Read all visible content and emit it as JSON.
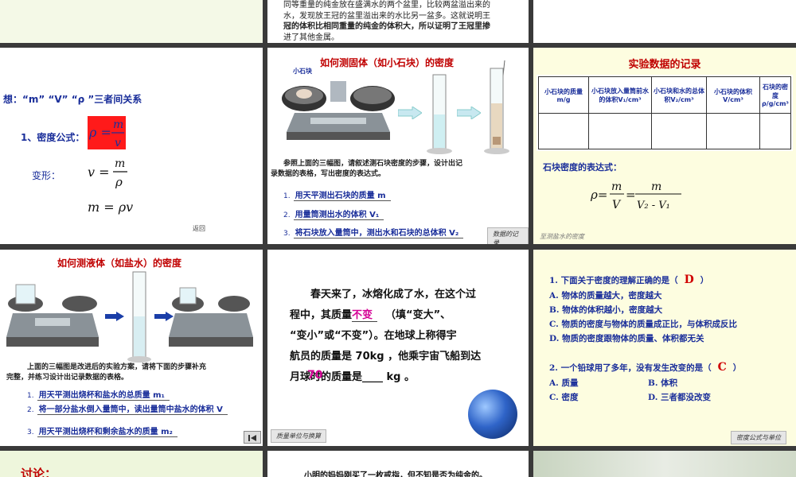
{
  "s1": {
    "text_lines": [
      "同等重量的纯金放在盛满水的两个盆里，比较两盆溢出来的",
      "水，发现放王冠的盆里溢出来的水比另一盆多。这就说明王",
      "冠的体积比相同重量的纯金的体积大，所以证明了王冠里掺",
      "进了其他金属。"
    ]
  },
  "s2": {
    "heading": "想：“m” “V” “ρ ”三者间关系",
    "formula_label": "1、密度公式：",
    "transform_label": "变形：",
    "back": "返回"
  },
  "s3": {
    "title": "如何测固体（如小石块）的密度",
    "stone_label": "小石块",
    "intro": [
      "参照上面的三幅图，请叙述测石块密度的步骤，设计出记",
      "录数据的表格，写出密度的表达式。"
    ],
    "steps": [
      {
        "num": "1.",
        "text": "用天平测出石块的质量 m"
      },
      {
        "num": "2.",
        "text": "用量筒测出水的体积 V₁"
      },
      {
        "num": "3.",
        "text": "将石块放入量筒中，测出水和石块的总体积 V₂"
      }
    ],
    "nav": "数据的记录"
  },
  "s4": {
    "title": "实验数据的记录",
    "headers": [
      "小石块的质量m/g",
      "小石块放入量筒前水的体积V₁/cm³",
      "小石块和水的总体积V₂/cm³",
      "小石块的体积V/cm³",
      "石块的密度ρ/g/cm³"
    ],
    "expr_label": "石块密度的表达式：",
    "nav": "至测盐水的密度"
  },
  "s5": {
    "title": "如何测液体（如盐水）的密度",
    "intro": [
      "上面的三幅图是改进后的实验方案，请将下面的步骤补充",
      "完整，并练习设计出记录数据的表格。"
    ],
    "steps": [
      {
        "num": "1.",
        "text": "用天平测出烧杯和盐水的总质量 m₁"
      },
      {
        "num": "2.",
        "text": "将一部分盐水倒入量筒中，读出量筒中盐水的体积 V"
      },
      {
        "num": "3.",
        "text": "用天平测出烧杯和剩余盐水的质量 m₂"
      }
    ]
  },
  "s6": {
    "lines": [
      "春天来了，冰熔化成了水，在这个过",
      "程中，其质量",
      "（填“变大”、",
      "“变小”或“不变”）。在地球上称得宇",
      "航员的质量是 70kg ，他乘宇宙飞船到达",
      "月球时的质量是____ kg 。"
    ],
    "answer1": "不变",
    "answer2": "70",
    "nav": "质量单位与换算"
  },
  "s7": {
    "q1": "1. 下面关于密度的理解正确的是（",
    "q1_ans": "D",
    "q1_end": "）",
    "q1_opts": [
      "A. 物体的质量越大，密度越大",
      "B. 物体的体积越小，密度越大",
      "C. 物质的密度与物体的质量成正比，与体积成反比",
      "D. 物质的密度跟物体的质量、体积都无关"
    ],
    "q2": "2. 一个铅球用了多年，没有发生改变的是（",
    "q2_ans": "C",
    "q2_end": "）",
    "q2_opts": [
      "A. 质量",
      "B. 体积",
      "C. 密度",
      "D. 三者都没改变"
    ],
    "nav": "密度公式与单位"
  },
  "s8": {
    "title": "讨论："
  },
  "s9": {
    "text": "小明的妈妈刚买了一枚戒指，但不知是否为纯金的。"
  }
}
